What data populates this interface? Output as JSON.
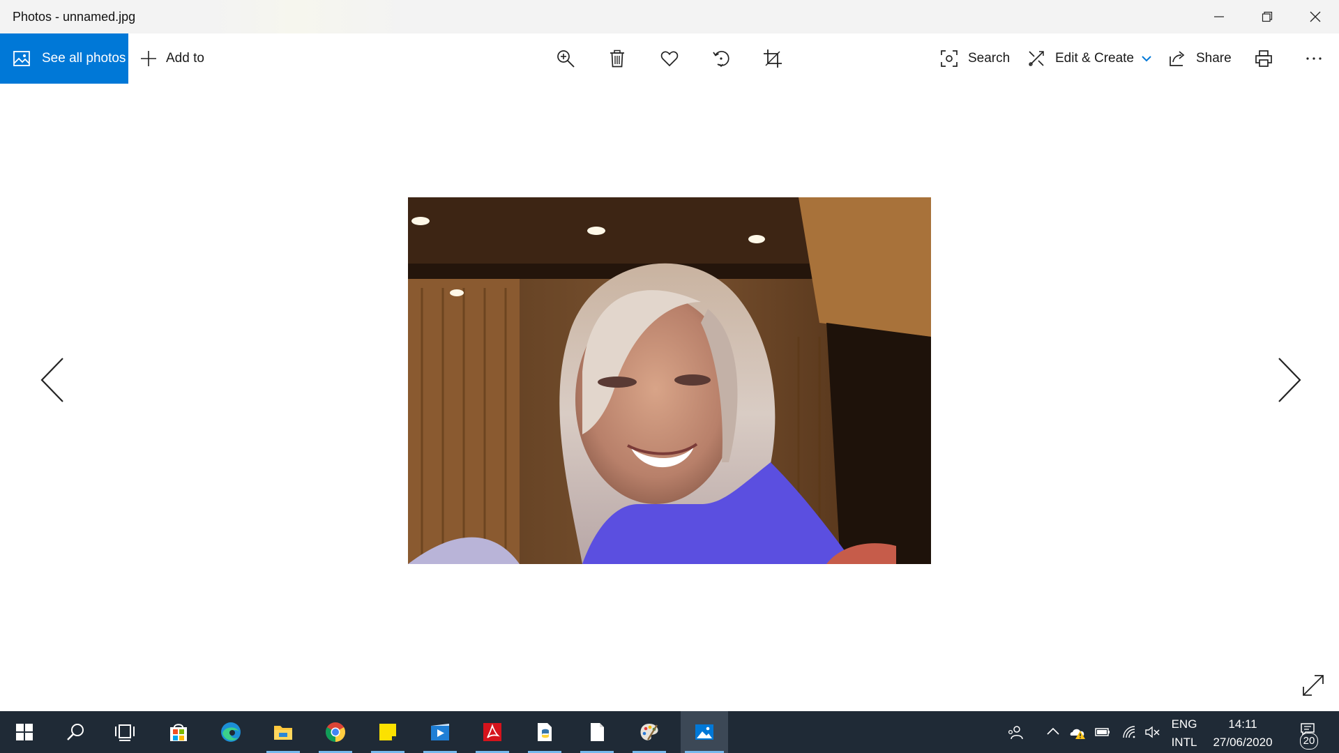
{
  "window": {
    "title": "Photos - unnamed.jpg",
    "controls": [
      "minimize-icon",
      "restore-icon",
      "close-icon"
    ]
  },
  "toolbar": {
    "see_all_label": "See all photos",
    "add_to_label": "Add to",
    "center_tools": [
      "zoom-in-icon",
      "delete-icon",
      "favorite-heart-icon",
      "rotate-icon",
      "crop-icon"
    ],
    "search_label": "Search",
    "edit_create_label": "Edit & Create",
    "share_label": "Share",
    "right_tools": [
      "print-icon",
      "more-options-icon"
    ],
    "accent_color": "#0078d7"
  },
  "viewer": {
    "photo_subject": "photo-image",
    "nav": [
      "previous-arrow-icon",
      "next-arrow-icon"
    ],
    "fullscreen_icon": "expand-icon"
  },
  "taskbar": {
    "apps": [
      "windows-start-icon",
      "search-icon",
      "task-view-icon",
      "microsoft-store-icon",
      "edge-icon",
      "file-explorer-icon",
      "chrome-icon",
      "sticky-notes-icon",
      "video-editor-icon",
      "acrobat-icon",
      "python-icon",
      "notepad-file-icon",
      "paint-icon",
      "photos-icon"
    ],
    "tray": [
      "people-icon",
      "show-hidden-icons-chevron",
      "onedrive-warning-icon",
      "battery-icon",
      "wifi-icon",
      "volume-muted-icon"
    ],
    "language_top": "ENG",
    "language_bottom": "INTL",
    "time": "14:11",
    "date": "27/06/2020",
    "notification_count": "20",
    "background_color": "#1f2a36"
  }
}
